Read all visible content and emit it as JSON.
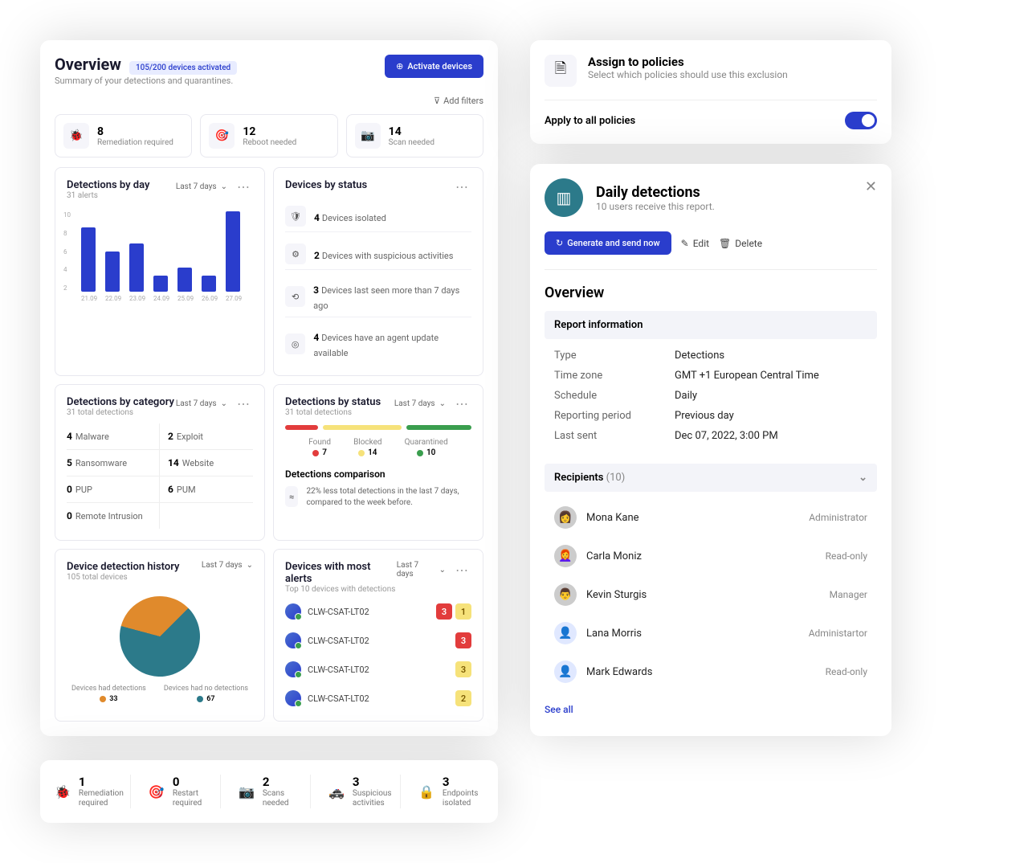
{
  "overview": {
    "title": "Overview",
    "badge": "105/200 devices activated",
    "subtitle": "Summary of your detections and quarantines.",
    "activate_btn": "Activate devices",
    "add_filters": "Add filters",
    "stats": [
      {
        "count": "8",
        "label": "Remediation required"
      },
      {
        "count": "12",
        "label": "Reboot needed"
      },
      {
        "count": "14",
        "label": "Scan needed"
      }
    ],
    "detections_by_day": {
      "title": "Detections by day",
      "sub": "31 alerts",
      "range": "Last 7 days"
    },
    "devices_status": {
      "title": "Devices by status",
      "rows": [
        {
          "n": "4",
          "t": "Devices isolated"
        },
        {
          "n": "2",
          "t": "Devices with suspicious activities"
        },
        {
          "n": "3",
          "t": "Devices last seen more than 7 days ago"
        },
        {
          "n": "4",
          "t": "Devices have an agent update available"
        }
      ]
    },
    "by_category": {
      "title": "Detections by category",
      "sub": "31 total detections",
      "range": "Last 7 days",
      "cats": [
        {
          "n": "4",
          "nm": "Malware"
        },
        {
          "n": "2",
          "nm": "Exploit"
        },
        {
          "n": "5",
          "nm": "Ransomware"
        },
        {
          "n": "14",
          "nm": "Website"
        },
        {
          "n": "0",
          "nm": "PUP"
        },
        {
          "n": "6",
          "nm": "PUM"
        },
        {
          "n": "0",
          "nm": "Remote Intrusion"
        },
        {
          "n": "",
          "nm": ""
        }
      ]
    },
    "by_status": {
      "title": "Detections by status",
      "sub": "31 total detections",
      "range": "Last 7 days",
      "legend": [
        {
          "lbl": "Found",
          "val": "7",
          "cls": "d-red"
        },
        {
          "lbl": "Blocked",
          "val": "14",
          "cls": "d-yel"
        },
        {
          "lbl": "Quarantined",
          "val": "10",
          "cls": "d-grn"
        }
      ],
      "comp_title": "Detections comparison",
      "comp_text": "22%  less total detections in the last 7 days, compared to the week before."
    },
    "history": {
      "title": "Device detection history",
      "sub": "105 total devices",
      "range": "Last 7 days",
      "legend": [
        {
          "lbl": "Devices had detections",
          "val": "33",
          "cls": "d-org"
        },
        {
          "lbl": "Devices had no detections",
          "val": "67",
          "cls": "d-tel"
        }
      ]
    },
    "most_alerts": {
      "title": "Devices with most alerts",
      "sub": "Top 10 devices with detections",
      "range": "Last 7 days",
      "rows": [
        {
          "name": "CLW-CSAT-LT02",
          "red": "3",
          "yel": "1"
        },
        {
          "name": "CLW-CSAT-LT02",
          "red": "3",
          "yel": ""
        },
        {
          "name": "CLW-CSAT-LT02",
          "red": "",
          "yel": "3"
        },
        {
          "name": "CLW-CSAT-LT02",
          "red": "",
          "yel": "2"
        }
      ]
    }
  },
  "chart_data": {
    "type": "bar",
    "title": "Detections by day",
    "categories": [
      "21.09",
      "22.09",
      "23.09",
      "24.09",
      "25.09",
      "26.09",
      "27.09"
    ],
    "values": [
      8,
      5,
      6,
      2,
      3,
      2,
      10
    ],
    "ylim": [
      0,
      10
    ],
    "yticks": [
      2,
      4,
      6,
      8,
      10
    ],
    "ylabel": "",
    "xlabel": ""
  },
  "bottom": {
    "items": [
      {
        "n": "1",
        "l1": "Remediation",
        "l2": "required"
      },
      {
        "n": "0",
        "l1": "Restart",
        "l2": "required"
      },
      {
        "n": "2",
        "l1": "Scans",
        "l2": "needed"
      },
      {
        "n": "3",
        "l1": "Suspicious",
        "l2": "activities"
      },
      {
        "n": "3",
        "l1": "Endpoints",
        "l2": "isolated"
      }
    ]
  },
  "assign": {
    "title": "Assign to policies",
    "sub": "Select which policies should use this exclusion",
    "apply_label": "Apply to all policies"
  },
  "report": {
    "title": "Daily detections",
    "sub": "10 users receive this report.",
    "generate": "Generate and send now",
    "edit": "Edit",
    "delete": "Delete",
    "section": "Overview",
    "info_head": "Report information",
    "info": [
      {
        "k": "Type",
        "v": "Detections"
      },
      {
        "k": "Time zone",
        "v": "GMT +1 European Central Time"
      },
      {
        "k": "Schedule",
        "v": "Daily"
      },
      {
        "k": "Reporting period",
        "v": "Previous day"
      },
      {
        "k": "Last sent",
        "v": "Dec 07, 2022, 3:00 PM"
      }
    ],
    "reci_head": "Recipients",
    "reci_ct": "(10)",
    "recipients": [
      {
        "name": "Mona Kane",
        "role": "Administrator",
        "av": "👩"
      },
      {
        "name": "Carla Moniz",
        "role": "Read-only",
        "av": "👩‍🦰"
      },
      {
        "name": "Kevin Sturgis",
        "role": "Manager",
        "av": "👨"
      },
      {
        "name": "Lana Morris",
        "role": "Administartor",
        "av": "blue"
      },
      {
        "name": "Mark Edwards",
        "role": "Read-only",
        "av": "blue"
      }
    ],
    "see_all": "See all"
  }
}
